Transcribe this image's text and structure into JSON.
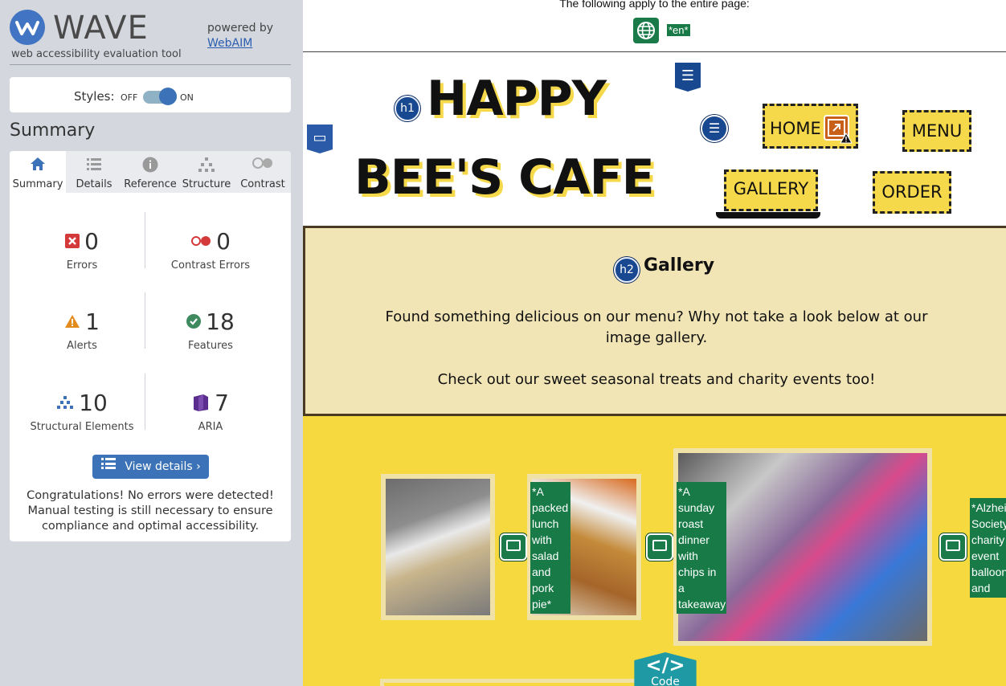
{
  "sidebar": {
    "logo_name": "WAVE",
    "tagline": "web accessibility evaluation tool",
    "powered_by": "powered by",
    "webaim_link": "WebAIM",
    "styles_label": "Styles:",
    "toggle_off": "OFF",
    "toggle_on": "ON",
    "summary_title": "Summary",
    "tabs": [
      {
        "label": "Summary",
        "icon": "home-icon"
      },
      {
        "label": "Details",
        "icon": "list-icon"
      },
      {
        "label": "Reference",
        "icon": "info-icon"
      },
      {
        "label": "Structure",
        "icon": "structure-icon"
      },
      {
        "label": "Contrast",
        "icon": "contrast-icon"
      }
    ],
    "stats": {
      "errors": {
        "count": "0",
        "label": "Errors"
      },
      "contrast_errors": {
        "count": "0",
        "label": "Contrast Errors"
      },
      "alerts": {
        "count": "1",
        "label": "Alerts"
      },
      "features": {
        "count": "18",
        "label": "Features"
      },
      "structural": {
        "count": "10",
        "label": "Structural Elements"
      },
      "aria": {
        "count": "7",
        "label": "ARIA"
      }
    },
    "view_details": "View details ›",
    "congrats": "Congratulations! No errors were detected! Manual testing is still necessary to ensure compliance and optimal accessibility."
  },
  "page": {
    "applies_text": "The following apply to the entire page:",
    "lang_badge": "*en*",
    "title_line1": "HAPPY",
    "title_line2": "BEE'S CAFE",
    "nav": {
      "home": "HOME",
      "menu": "MENU",
      "gallery": "GALLERY",
      "order": "ORDER"
    },
    "badges": {
      "h1": "h1",
      "h2": "h2"
    },
    "gallery_heading": "Gallery",
    "gallery_text1": "Found something delicious on our menu? Why not take a look below at our image gallery.",
    "gallery_text2": "Check out our sweet seasonal treats and charity events too!",
    "alts": [
      "*A packed lunch with salad and pork pie*",
      "*A sunday roast dinner with chips in a takeaway tray*",
      "*Alzheimer's Society charity event balloons and cake*"
    ],
    "code_label": "Code",
    "code_symbol": "</>"
  },
  "colors": {
    "wave_blue": "#3c73b8",
    "wave_green": "#1a7a4a",
    "cafe_yellow": "#f6d93f",
    "panel_bg": "#d4d8de"
  }
}
